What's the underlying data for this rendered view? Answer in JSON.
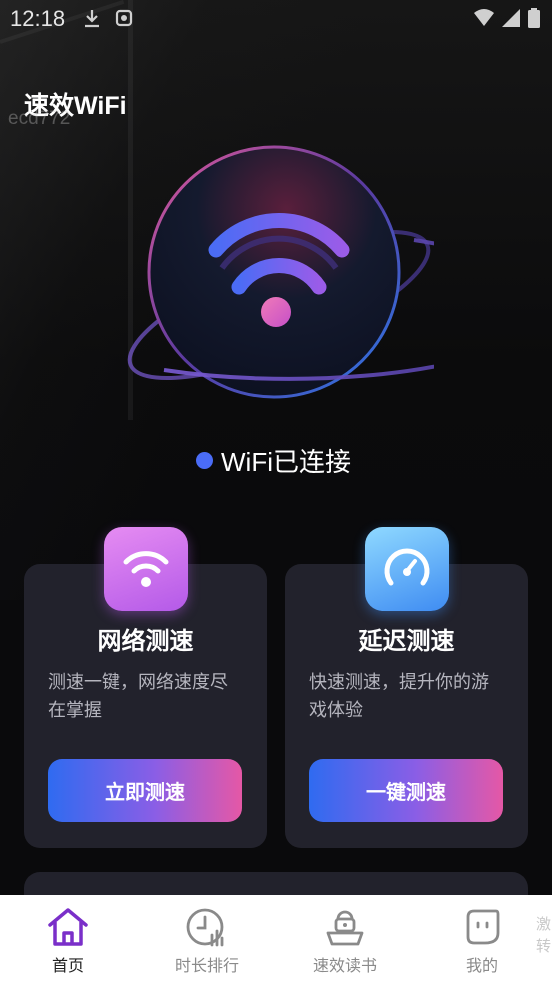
{
  "status_bar": {
    "time": "12:18"
  },
  "app": {
    "title": "速效WiFi",
    "watermark": "ecd772"
  },
  "connection": {
    "status": "WiFi已连接",
    "dot_color": "#4a6cf7"
  },
  "cards": [
    {
      "icon": "wifi-icon",
      "title": "网络测速",
      "description": "测速一键，网络速度尽在掌握",
      "button_label": "立即测速"
    },
    {
      "icon": "speedometer-icon",
      "title": "延迟测速",
      "description": "快速测速，提升你的游戏体验",
      "button_label": "一键测速"
    }
  ],
  "bottom_nav": {
    "items": [
      {
        "label": "首页",
        "icon": "home-icon",
        "active": true
      },
      {
        "label": "时长排行",
        "icon": "clock-chart-icon",
        "active": false
      },
      {
        "label": "速效读书",
        "icon": "book-icon",
        "active": false
      },
      {
        "label": "我的",
        "icon": "profile-icon",
        "active": false
      }
    ],
    "cut_off_label": "激转"
  },
  "colors": {
    "accent_purple": "#7a2fc9",
    "button_gradient": [
      "#2f6bf0",
      "#8a5ee6",
      "#e558a6"
    ],
    "card_bg": "#22222c"
  }
}
